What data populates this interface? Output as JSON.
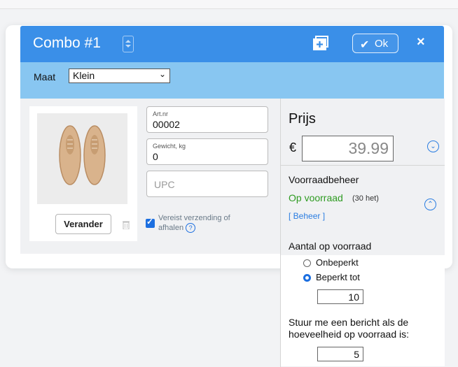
{
  "header": {
    "title": "Combo #1",
    "ok_label": "Ok",
    "close_label": "×",
    "bg_color": "#3a8fe8"
  },
  "size": {
    "label": "Maat",
    "selected": "Klein"
  },
  "product": {
    "change_button": "Verander",
    "fields": {
      "article": {
        "label": "Art.nr",
        "value": "00002"
      },
      "weight": {
        "label": "Gewicht, kg",
        "value": "0"
      },
      "upc": {
        "placeholder": "UPC"
      }
    },
    "shipping_label": "Vereist verzending of afhalen",
    "shipping_checked": true
  },
  "price": {
    "title": "Prijs",
    "currency": "€",
    "value": "39.99"
  },
  "stock": {
    "title": "Voorraadbeheer",
    "status": "Op voorraad",
    "status_color": "#2e9b21",
    "count": "(30 het)",
    "manage_link": "[ Beheer ]",
    "qty_title": "Aantal op voorraad",
    "option_unlimited": "Onbeperkt",
    "option_limited": "Beperkt tot",
    "limit_value": "10",
    "notify_text": "Stuur me een bericht als de hoeveelheid op voorraad is:",
    "notify_value": "5"
  }
}
